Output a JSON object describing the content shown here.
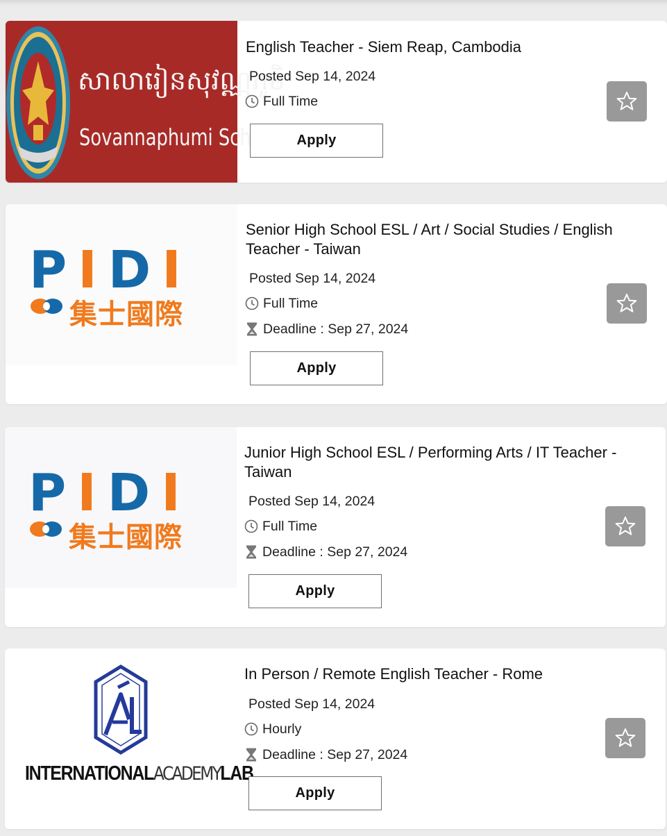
{
  "colors": {
    "page_background": "#ececec",
    "card_background": "#ffffff",
    "favorite_button": "#999999",
    "sovannaphumi_red": "#a82a27",
    "pidi_blue": "#1569a8",
    "pidi_orange": "#f07a1d",
    "ial_blue": "#253a9a"
  },
  "icons": {
    "job_type": "clock-icon",
    "deadline": "hourglass-icon",
    "favorite": "star-outline-icon"
  },
  "jobs": [
    {
      "logo": {
        "khmer_text": "សាលារៀនសុវណ្ណភូមិ",
        "name_text": "Sovannaphumi School"
      },
      "title": "English Teacher - Siem Reap, Cambodia",
      "posted": "Posted Sep 14, 2024",
      "job_type": "Full Time",
      "apply_label": "Apply"
    },
    {
      "logo": {
        "letters": [
          "P",
          "I",
          "D",
          "I"
        ],
        "chinese_text": "集士國際"
      },
      "title": "Senior High School ESL / Art / Social Studies / English Teacher - Taiwan",
      "posted": "Posted Sep 14, 2024",
      "job_type": "Full Time",
      "deadline": "Deadline : Sep 27, 2024",
      "apply_label": "Apply"
    },
    {
      "logo": {
        "letters": [
          "P",
          "I",
          "D",
          "I"
        ],
        "chinese_text": "集士國際"
      },
      "title": "Junior High School ESL / Performing Arts / IT Teacher - Taiwan",
      "posted": "Posted Sep 14, 2024",
      "job_type": "Full Time",
      "deadline": "Deadline : Sep 27, 2024",
      "apply_label": "Apply"
    },
    {
      "logo": {
        "wordmark_bold_1": "INTERNATIONAL",
        "wordmark_light": "ACADEMY",
        "wordmark_bold_2": "LAB"
      },
      "title": "In Person / Remote English Teacher - Rome",
      "posted": "Posted Sep 14, 2024",
      "job_type": "Hourly",
      "deadline": "Deadline : Sep 27, 2024",
      "apply_label": "Apply"
    }
  ]
}
